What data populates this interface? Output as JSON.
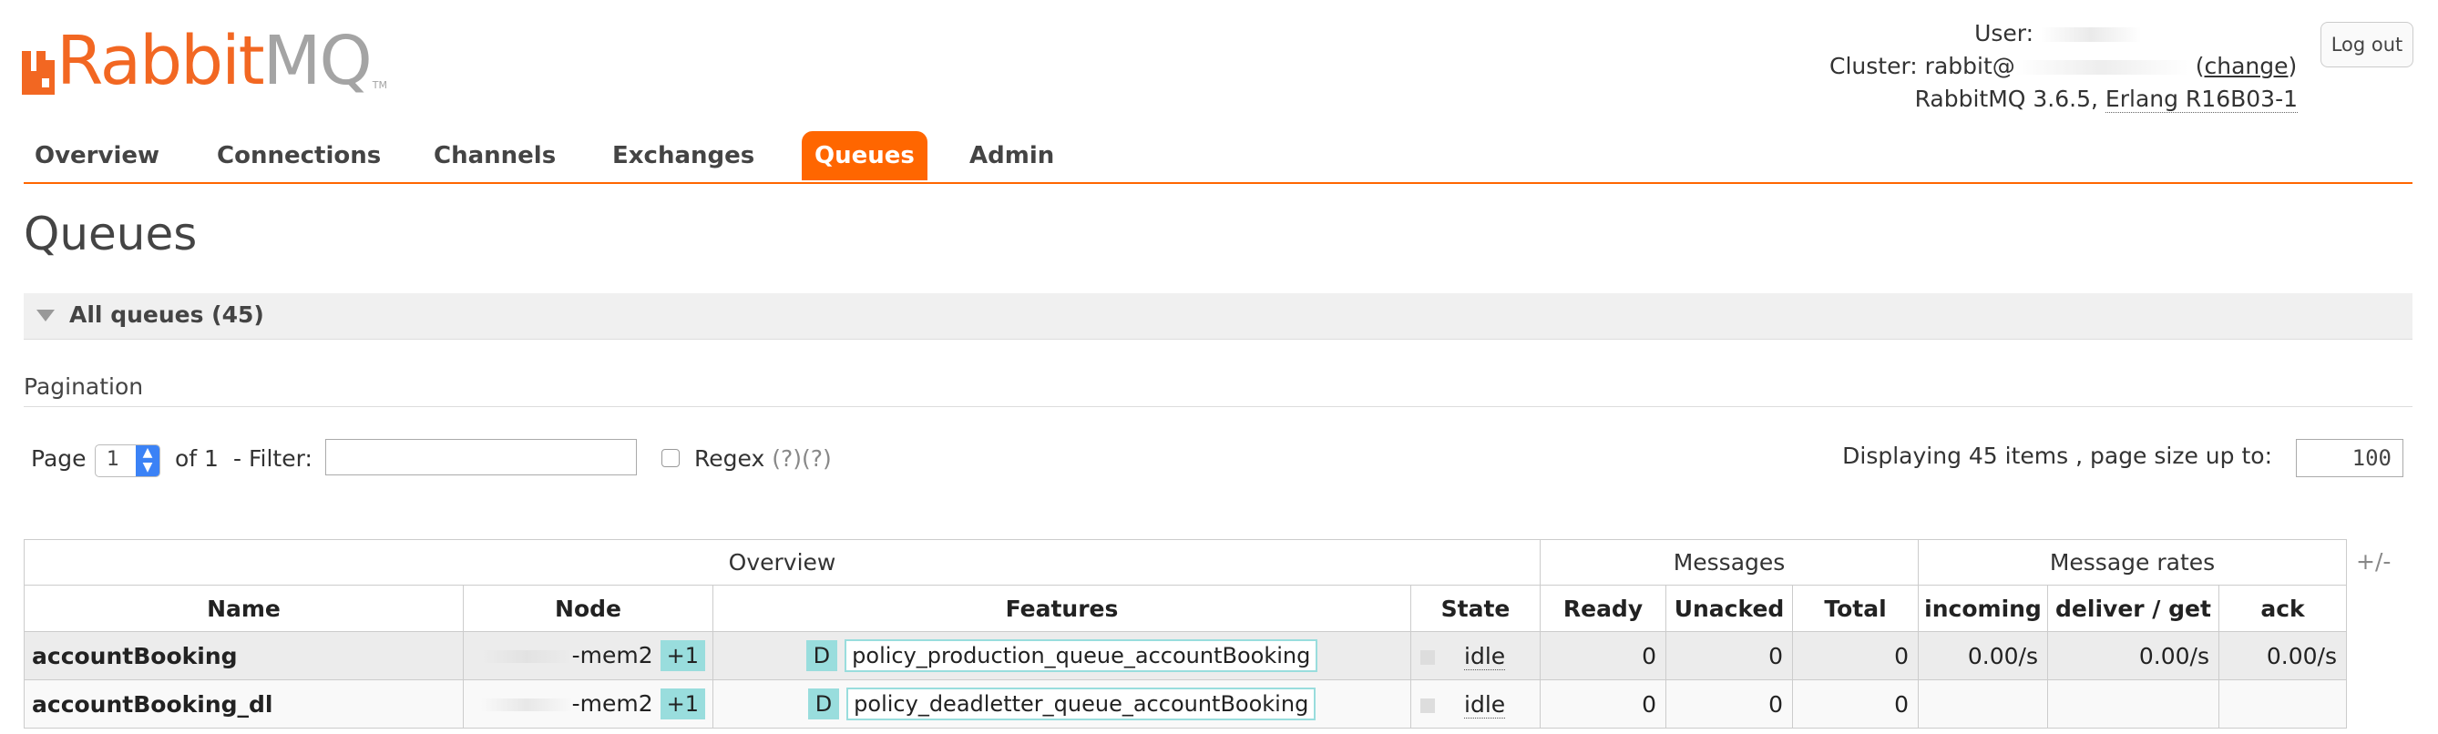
{
  "brand": {
    "name_part1": "Rabbit",
    "name_part2": "MQ",
    "trademark": "TM",
    "colors": {
      "orange": "#f26722",
      "grey": "#a4a4a4",
      "tab_active": "#ff6600",
      "badge": "#99dddd"
    }
  },
  "header": {
    "user_label": "User:",
    "cluster_label": "Cluster:",
    "cluster_name": "rabbit@",
    "change_open": "(",
    "change_link": "change",
    "change_close": ")",
    "version_text": "RabbitMQ 3.6.5,",
    "erlang_text": "Erlang R16B03-1",
    "logout_label": "Log out"
  },
  "tabs": [
    {
      "label": "Overview",
      "active": false
    },
    {
      "label": "Connections",
      "active": false
    },
    {
      "label": "Channels",
      "active": false
    },
    {
      "label": "Exchanges",
      "active": false
    },
    {
      "label": "Queues",
      "active": true
    },
    {
      "label": "Admin",
      "active": false
    }
  ],
  "page_title": "Queues",
  "section": {
    "label": "All queues (45)"
  },
  "pagination": {
    "title": "Pagination",
    "page_label": "Page",
    "page_value": "1",
    "of_label": "of 1",
    "filter_label": "- Filter:",
    "filter_value": "",
    "regex_label": "Regex",
    "regex_help": "(?)(?)",
    "display_text": "Displaying 45 items , page size up to:",
    "page_size": "100"
  },
  "table": {
    "groups": [
      "Overview",
      "Messages",
      "Message rates"
    ],
    "plus_minus": "+/-",
    "columns": [
      "Name",
      "Node",
      "Features",
      "State",
      "Ready",
      "Unacked",
      "Total",
      "incoming",
      "deliver / get",
      "ack"
    ],
    "rows": [
      {
        "name": "accountBooking",
        "node": "-mem2",
        "mirrors": "+1",
        "durable": "D",
        "policy": "policy_production_queue_accountBooking",
        "state": "idle",
        "ready": "0",
        "unacked": "0",
        "total": "0",
        "incoming": "0.00/s",
        "deliver_get": "0.00/s",
        "ack": "0.00/s"
      },
      {
        "name": "accountBooking_dl",
        "node": "-mem2",
        "mirrors": "+1",
        "durable": "D",
        "policy": "policy_deadletter_queue_accountBooking",
        "state": "idle",
        "ready": "0",
        "unacked": "0",
        "total": "0",
        "incoming": "",
        "deliver_get": "",
        "ack": ""
      }
    ]
  }
}
